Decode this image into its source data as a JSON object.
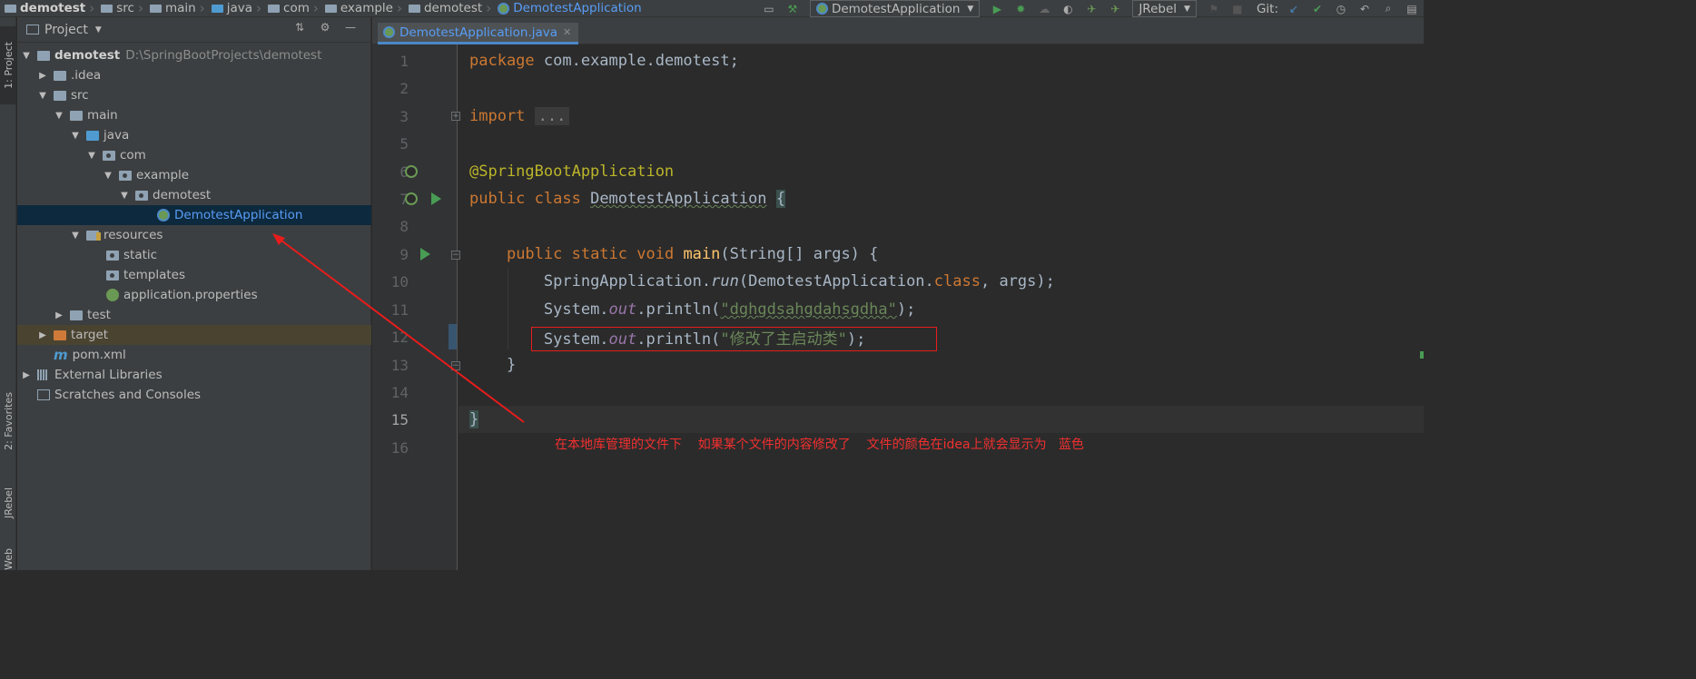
{
  "navbar": {
    "breadcrumbs": [
      "demotest",
      "src",
      "main",
      "java",
      "com",
      "example",
      "demotest",
      "DemotestApplication"
    ],
    "run_config": "DemotestApplication",
    "jrebel": "JRebel",
    "git_label": "Git:"
  },
  "left_strip": {
    "tabs": [
      "1: Project",
      "2: Favorites",
      "JRebel",
      "Web"
    ]
  },
  "project": {
    "title": "Project",
    "root_name": "demotest",
    "root_path": "D:\\SpringBootProjects\\demotest",
    "items": {
      "idea": ".idea",
      "src": "src",
      "main": "main",
      "java": "java",
      "com": "com",
      "example": "example",
      "demotest": "demotest",
      "app": "DemotestApplication",
      "resources": "resources",
      "static": "static",
      "templates": "templates",
      "props": "application.properties",
      "test": "test",
      "target": "target",
      "pom": "pom.xml",
      "libs": "External Libraries",
      "scratches": "Scratches and Consoles"
    }
  },
  "editor": {
    "tab": "DemotestApplication.java",
    "line_numbers": [
      "1",
      "2",
      "3",
      "5",
      "6",
      "7",
      "8",
      "9",
      "10",
      "11",
      "12",
      "13",
      "14",
      "15",
      "16"
    ],
    "code": {
      "l1_kw": "package",
      "l1_rest": " com.example.demotest;",
      "l3_kw": "import",
      "l3_fold": "...",
      "l6": "@SpringBootApplication",
      "l7_kw": "public class",
      "l7_name": "DemotestApplication",
      "l7_brace": "{",
      "l9_kw": "public static void",
      "l9_fn": "main",
      "l9_rest": "(String[] args) {",
      "l10_a": "SpringApplication.",
      "l10_run": "run",
      "l10_b": "(DemotestApplication.",
      "l10_class": "class",
      "l10_c": ", args);",
      "l11_a": "System.",
      "l11_out": "out",
      "l11_b": ".println(",
      "l11_str": "\"dghgdsahgdahsgdha\"",
      "l11_c": ");",
      "l12_a": "System.",
      "l12_out": "out",
      "l12_b": ".println(",
      "l12_str": "\"修改了主启动类\"",
      "l12_c": ");",
      "l13": "}",
      "l15": "}"
    }
  },
  "annotation_text": "在本地库管理的文件下    如果某个文件的内容修改了    文件的颜色在idea上就会显示为   蓝色",
  "colors": {
    "annotation_red": "#e81c1c",
    "modified_blue": "#589df6",
    "keyword": "#cc7832",
    "string": "#6a8759"
  }
}
